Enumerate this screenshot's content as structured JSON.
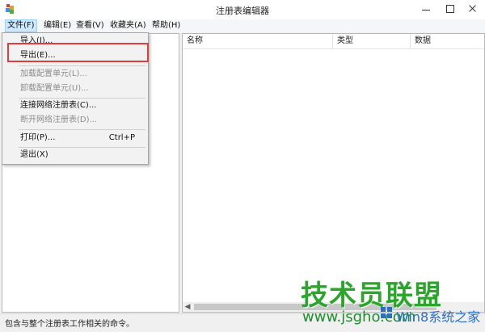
{
  "window": {
    "title": "注册表编辑器"
  },
  "menubar": {
    "items": [
      "文件(F)",
      "编辑(E)",
      "查看(V)",
      "收藏夹(A)",
      "帮助(H)"
    ]
  },
  "file_menu": {
    "items": [
      {
        "label": "导入(I)...",
        "disabled": false
      },
      {
        "label": "导出(E)...",
        "disabled": false
      },
      {
        "label": "加载配置单元(L)...",
        "disabled": true
      },
      {
        "label": "卸载配置单元(U)...",
        "disabled": true
      },
      {
        "label": "连接网络注册表(C)...",
        "disabled": false
      },
      {
        "label": "断开网络注册表(D)...",
        "disabled": true
      },
      {
        "label": "打印(P)...",
        "shortcut": "Ctrl+P",
        "disabled": false
      },
      {
        "label": "退出(X)",
        "disabled": false
      }
    ]
  },
  "list_view": {
    "columns": [
      "名称",
      "类型",
      "数据"
    ]
  },
  "statusbar": {
    "text": "包含与整个注册表工作相关的命令。"
  },
  "watermark": {
    "title": "技术员联盟",
    "url": "www.jsgho.com",
    "sub": "Win8系统之家"
  },
  "colors": {
    "highlight": "#e03c3c",
    "menu_active": "#cce8ff",
    "watermark_green": "#2aa62a"
  }
}
